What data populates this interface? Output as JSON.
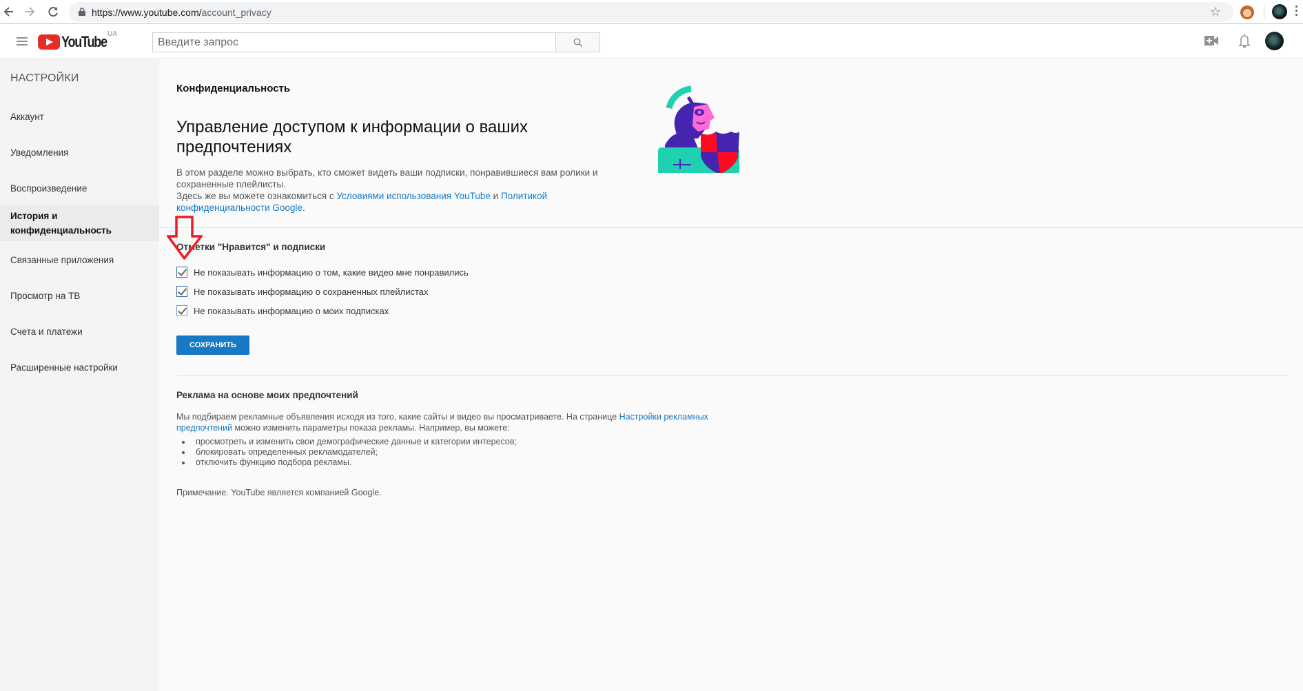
{
  "browser": {
    "url_host": "https://www.youtube.com/",
    "url_path": "account_privacy",
    "back_icon": "arrow-left",
    "forward_icon": "arrow-right",
    "reload_icon": "reload",
    "bookmark_icon": "star-outline"
  },
  "header": {
    "logo_text": "YouTube",
    "region": "UA",
    "search_placeholder": "Введите запрос",
    "search_value": "",
    "icons": [
      "menu-icon",
      "upload-video-icon",
      "notifications-bell-icon",
      "avatar"
    ]
  },
  "sidebar": {
    "title": "НАСТРОЙКИ",
    "items": [
      {
        "label": "Аккаунт",
        "active": false
      },
      {
        "label": "Уведомления",
        "active": false
      },
      {
        "label": "Воспроизведение",
        "active": false
      },
      {
        "label": "История и конфиденциальность",
        "active": true
      },
      {
        "label": "Связанные приложения",
        "active": false
      },
      {
        "label": "Просмотр на ТВ",
        "active": false
      },
      {
        "label": "Счета и платежи",
        "active": false
      },
      {
        "label": "Расширенные настройки",
        "active": false
      }
    ]
  },
  "main": {
    "section_label": "Конфиденциальность",
    "headline": "Управление доступом к информации о ваших предпочтениях",
    "intro": {
      "line1": "В этом разделе можно выбрать, кто сможет видеть ваши подписки, понравившиеся вам ролики и сохраненные плейлисты.",
      "line2_prefix": "Здесь же вы можете ознакомиться с ",
      "terms_link": "Условиями использования YouTube",
      "and": " и ",
      "privacy_link": "Политикой конфиденциальности Google",
      "suffix": "."
    },
    "likes_section": {
      "title": "Отметки \"Нравится\" и подписки",
      "checkboxes": [
        {
          "label": "Не показывать информацию о том, какие видео мне понравились",
          "checked": true
        },
        {
          "label": "Не показывать информацию о сохраненных плейлистах",
          "checked": true
        },
        {
          "label": "Не показывать информацию о моих подписках",
          "checked": true
        }
      ],
      "save_label": "СОХРАНИТЬ"
    },
    "ads_section": {
      "title": "Реклама на основе моих предпочтений",
      "text_prefix": "Мы подбираем рекламные объявления исходя из того, какие сайты и видео вы просматриваете. На странице ",
      "settings_link": "Настройки рекламных предпочтений",
      "text_suffix": " можно изменить параметры показа рекламы. Например, вы можете:",
      "bullets": [
        "просмотреть и изменить свои демографические данные и категории интересов;",
        "блокировать определенных рекламодателей;",
        "отключить функцию подбора рекламы."
      ]
    },
    "note": "Примечание. YouTube является компанией Google."
  },
  "colors": {
    "brand_red": "#e52d27",
    "link_blue": "#167ac6",
    "button_blue": "#167ac6",
    "annotation_arrow": "#ed1c24"
  }
}
